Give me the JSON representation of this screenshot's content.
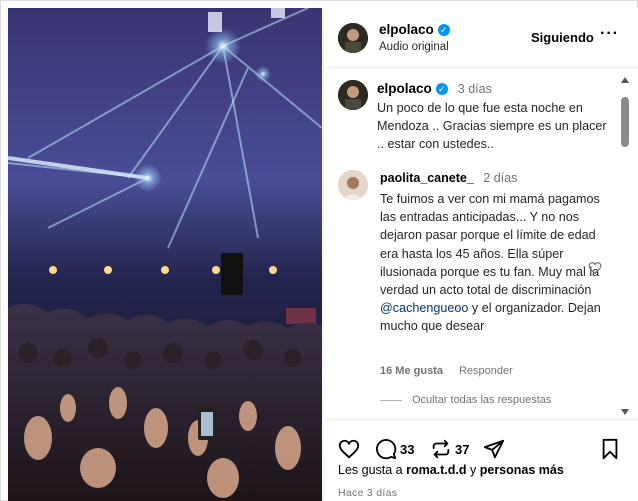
{
  "header": {
    "username": "elpolaco",
    "subtitle": "Audio original",
    "follow_label": "Siguiendo",
    "more_label": "···"
  },
  "caption": {
    "username": "elpolaco",
    "time": "3 días",
    "text": "Un poco de lo que fue esta noche en Mendoza .. Gracias siempre es un placer .. estar con ustedes.."
  },
  "reply": {
    "username": "paolita_canete_",
    "time": "2 días",
    "text_before": "Te fuimos a ver con mi mamá pagamos las entradas anticipadas... Y no nos dejaron pasar porque el límite de edad era hasta los 45 años. Ella súper ilusionada porque es tu fan. Muy mal la verdad un acto total de discriminación ",
    "mention": "@cachengueoo",
    "text_after": " y el organizador. Dejan mucho que desear",
    "likes": "16 Me gusta",
    "reply_label": "Responder",
    "hide_replies": "Ocultar todas las respuestas"
  },
  "actions": {
    "comments_count": "33",
    "reposts_count": "37",
    "likes_prefix": "Les gusta a ",
    "likes_user": "roma.t.d.d",
    "likes_join": " y ",
    "likes_rest": "personas más",
    "posted_ago": "Hace 3 días"
  },
  "icons": {
    "verified": "verified-badge-icon",
    "like": "heart-icon",
    "comment": "comment-bubble-icon",
    "repost": "repost-arrows-icon",
    "share": "paper-plane-icon",
    "save": "bookmark-icon"
  },
  "colors": {
    "verified": "#0095f6",
    "muted": "#737373",
    "mention": "#00376b"
  }
}
